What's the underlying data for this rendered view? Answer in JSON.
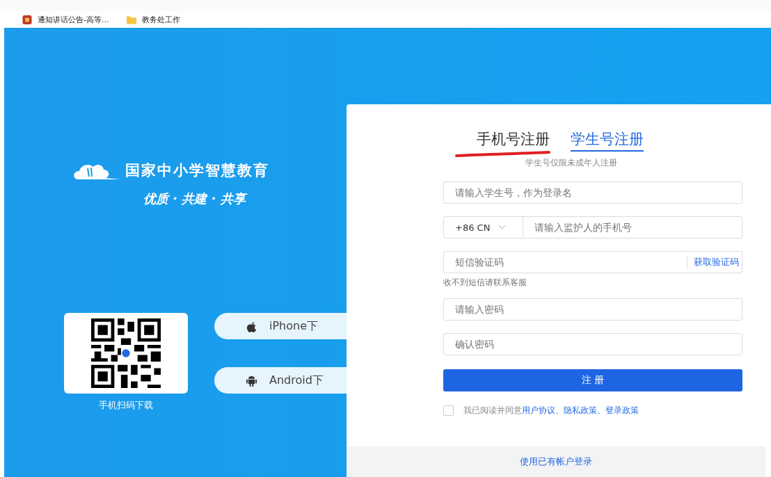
{
  "bookmarks": [
    {
      "label": "通知讲话公告-高等...",
      "kind": "site"
    },
    {
      "label": "教务处工作",
      "kind": "folder"
    }
  ],
  "brand": {
    "title": "国家中小学智慧教育",
    "slogan": "优质 · 共建 · 共享"
  },
  "qr": {
    "caption": "手机扫码下载"
  },
  "downloads": [
    {
      "label": "iPhone下",
      "kind": "apple"
    },
    {
      "label": "Android下",
      "kind": "android"
    }
  ],
  "tabs": [
    {
      "label": "手机号注册",
      "selected": false
    },
    {
      "label": "学生号注册",
      "selected": true
    }
  ],
  "tab_hint": "学生号仅限未成年人注册",
  "fields": [
    {
      "kind": "text",
      "placeholder": "请输入学生号，作为登录名"
    },
    {
      "kind": "phone",
      "prefix": "+86 CN",
      "placeholder": "请输入监护人的手机号"
    },
    {
      "kind": "code",
      "placeholder": "短信验证码",
      "action": "获取验证码",
      "note": "收不到短信请联系客服"
    },
    {
      "kind": "text",
      "placeholder": "请输入密码"
    },
    {
      "kind": "text",
      "placeholder": "确认密码"
    }
  ],
  "submit": "注 册",
  "agreement": {
    "checked": false,
    "text": "我已阅读并同意",
    "links": [
      "用户协议",
      "、",
      "隐私政策",
      "、",
      "登录政策"
    ]
  },
  "footer_link": "使用已有帐户登录"
}
